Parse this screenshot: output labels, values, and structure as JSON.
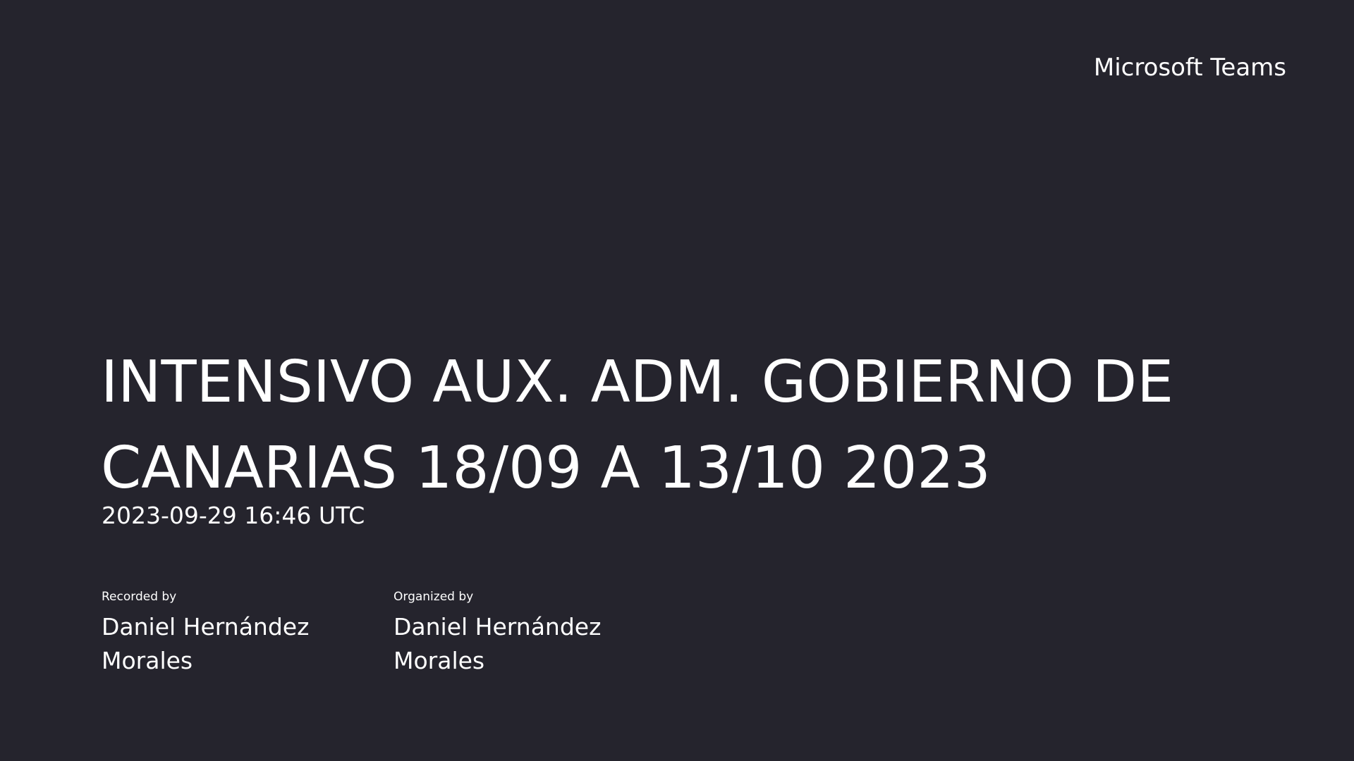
{
  "brand": {
    "name": "Microsoft Teams"
  },
  "meeting": {
    "title": "INTENSIVO AUX. ADM. GOBIERNO DE CANARIAS 18/09 A 13/10 2023",
    "datetime": "2023-09-29 16:46 UTC"
  },
  "people": {
    "recorded_by_label": "Recorded by",
    "recorded_by_name": "Daniel Hernández Morales",
    "organized_by_label": "Organized by",
    "organized_by_name": "Daniel Hernández Morales"
  },
  "colors": {
    "background": "#25242d",
    "text": "#ffffff"
  }
}
